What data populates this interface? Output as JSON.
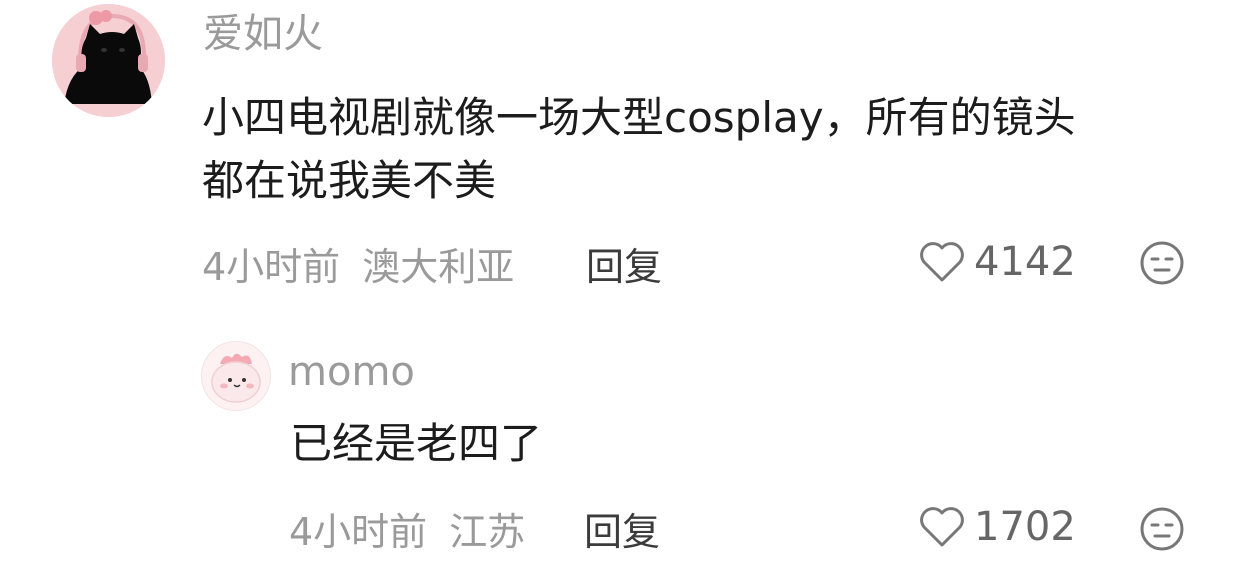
{
  "comments": [
    {
      "username": "爱如火",
      "text_lines": [
        "小四电视剧就像一场大型cosplay，所有的镜头",
        "都在说我美不美"
      ],
      "time": "4小时前",
      "location": "澳大利亚",
      "reply_label": "回复",
      "likes": "4142",
      "like_icon": "heart-outline-icon",
      "dislike_icon": "neutral-face-icon",
      "replies": [
        {
          "username": "momo",
          "text": "已经是老四了",
          "time": "4小时前",
          "location": "江苏",
          "reply_label": "回复",
          "likes": "1702",
          "like_icon": "heart-outline-icon",
          "dislike_icon": "neutral-face-icon"
        }
      ]
    }
  ],
  "colors": {
    "username": "#9a9a9a",
    "text": "#1c1c1c",
    "meta": "#9a9a9a",
    "reply": "#3b3b3b",
    "icon": "#777777"
  }
}
